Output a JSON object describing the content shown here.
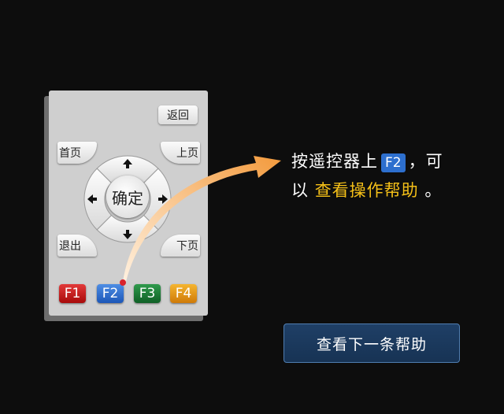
{
  "remote": {
    "back_label": "返回",
    "home_label": "首页",
    "page_up_label": "上页",
    "exit_label": "退出",
    "page_down_label": "下页",
    "ok_label": "确定",
    "f_keys": [
      "F1",
      "F2",
      "F3",
      "F4"
    ],
    "dpad_icons": [
      "arrow-up-icon",
      "arrow-down-icon",
      "arrow-left-icon",
      "arrow-right-icon"
    ]
  },
  "help": {
    "line1_prefix": "按遥控器上",
    "key": "F2",
    "line1_suffix": "，可",
    "line2_prefix": "以",
    "line2_highlight": "查看操作帮助",
    "line2_suffix": "。"
  },
  "next_button_label": "查看下一条帮助",
  "colors": {
    "background": "#0d0d0d",
    "highlight": "#f5c018",
    "f1": "#c41e1e",
    "f2": "#2d6fce",
    "f3": "#1d7a35",
    "f4": "#e59a12",
    "pointer_arrow": "#f5a04a"
  }
}
